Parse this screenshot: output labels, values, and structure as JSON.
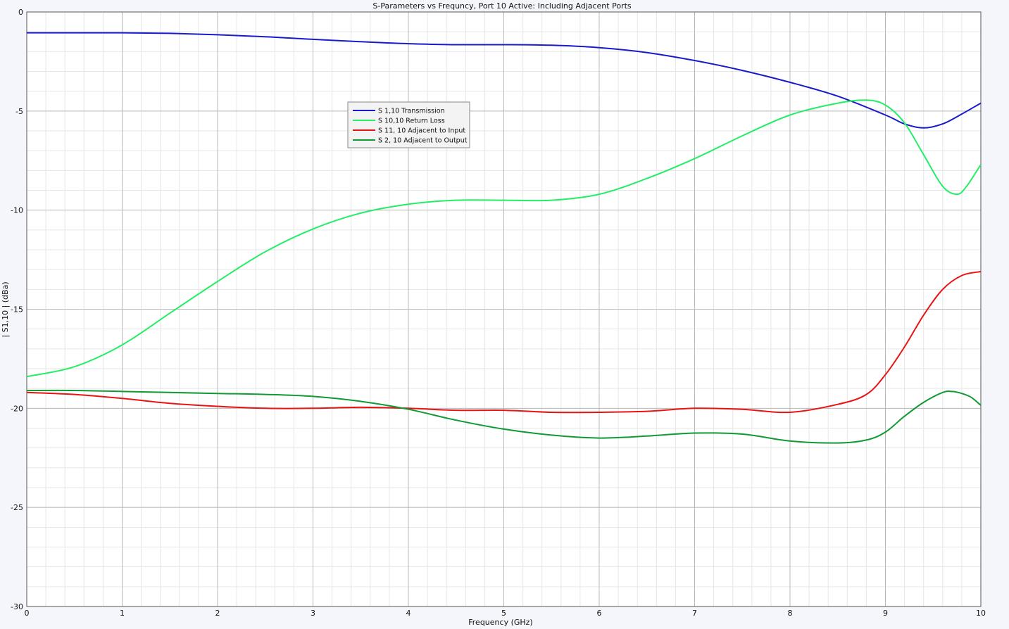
{
  "chart_data": {
    "type": "line",
    "title": "S-Parameters vs Frequncy, Port 10 Active:  Including Adjacent Ports",
    "xlabel": "Frequency (GHz)",
    "ylabel": "| S1,10 | (dBa)",
    "xlim": [
      0,
      10
    ],
    "ylim": [
      -30,
      0
    ],
    "x_ticks": [
      "0",
      "1",
      "2",
      "3",
      "4",
      "5",
      "6",
      "7",
      "8",
      "9",
      "10"
    ],
    "y_ticks": [
      "0",
      "-5",
      "-10",
      "-15",
      "-20",
      "-25",
      "-30"
    ],
    "grid": true,
    "legend_position": "upper-center",
    "series": [
      {
        "name": "S 1,10 Transmission",
        "color": "#1a1acc",
        "x": [
          0,
          0.5,
          1,
          1.5,
          2,
          2.5,
          3,
          3.5,
          4,
          4.5,
          5,
          5.5,
          6,
          6.5,
          7,
          7.5,
          8,
          8.5,
          9,
          9.2,
          9.4,
          9.6,
          9.8,
          10
        ],
        "y": [
          -1.05,
          -1.05,
          -1.05,
          -1.08,
          -1.15,
          -1.25,
          -1.38,
          -1.5,
          -1.6,
          -1.65,
          -1.65,
          -1.68,
          -1.8,
          -2.05,
          -2.45,
          -2.95,
          -3.55,
          -4.25,
          -5.2,
          -5.65,
          -5.85,
          -5.65,
          -5.15,
          -4.6
        ]
      },
      {
        "name": "S 10,10 Return Loss",
        "color": "#22ee66",
        "x": [
          0,
          0.5,
          1,
          1.5,
          2,
          2.5,
          3,
          3.5,
          4,
          4.5,
          5,
          5.5,
          6,
          6.5,
          7,
          7.5,
          8,
          8.5,
          8.8,
          9,
          9.2,
          9.4,
          9.6,
          9.75,
          9.85,
          10
        ],
        "y": [
          -18.4,
          -17.9,
          -16.8,
          -15.2,
          -13.6,
          -12.1,
          -10.95,
          -10.15,
          -9.7,
          -9.5,
          -9.5,
          -9.5,
          -9.2,
          -8.4,
          -7.4,
          -6.25,
          -5.2,
          -4.6,
          -4.45,
          -4.7,
          -5.6,
          -7.2,
          -8.8,
          -9.2,
          -8.8,
          -7.7
        ]
      },
      {
        "name": "S 11, 10 Adjacent to Input",
        "color": "#e81414",
        "x": [
          0,
          0.5,
          1,
          1.5,
          2,
          2.5,
          3,
          3.5,
          4,
          4.5,
          5,
          5.5,
          6,
          6.5,
          7,
          7.5,
          8,
          8.5,
          8.8,
          9,
          9.2,
          9.4,
          9.6,
          9.8,
          10
        ],
        "y": [
          -19.2,
          -19.3,
          -19.5,
          -19.75,
          -19.9,
          -20.0,
          -20.0,
          -19.95,
          -20.0,
          -20.1,
          -20.1,
          -20.2,
          -20.2,
          -20.15,
          -20.0,
          -20.05,
          -20.2,
          -19.8,
          -19.3,
          -18.3,
          -16.9,
          -15.3,
          -14.0,
          -13.3,
          -13.1
        ]
      },
      {
        "name": "S 2, 10 Adjacent to Output",
        "color": "#119933",
        "x": [
          0,
          0.5,
          1,
          1.5,
          2,
          2.5,
          3,
          3.5,
          4,
          4.5,
          5,
          5.5,
          6,
          6.5,
          7,
          7.5,
          8,
          8.5,
          8.8,
          9,
          9.2,
          9.4,
          9.6,
          9.7,
          9.8,
          9.9,
          10
        ],
        "y": [
          -19.1,
          -19.1,
          -19.15,
          -19.2,
          -19.25,
          -19.3,
          -19.4,
          -19.65,
          -20.05,
          -20.6,
          -21.05,
          -21.35,
          -21.5,
          -21.4,
          -21.25,
          -21.3,
          -21.65,
          -21.75,
          -21.6,
          -21.2,
          -20.4,
          -19.7,
          -19.2,
          -19.15,
          -19.25,
          -19.45,
          -19.85
        ]
      }
    ]
  }
}
